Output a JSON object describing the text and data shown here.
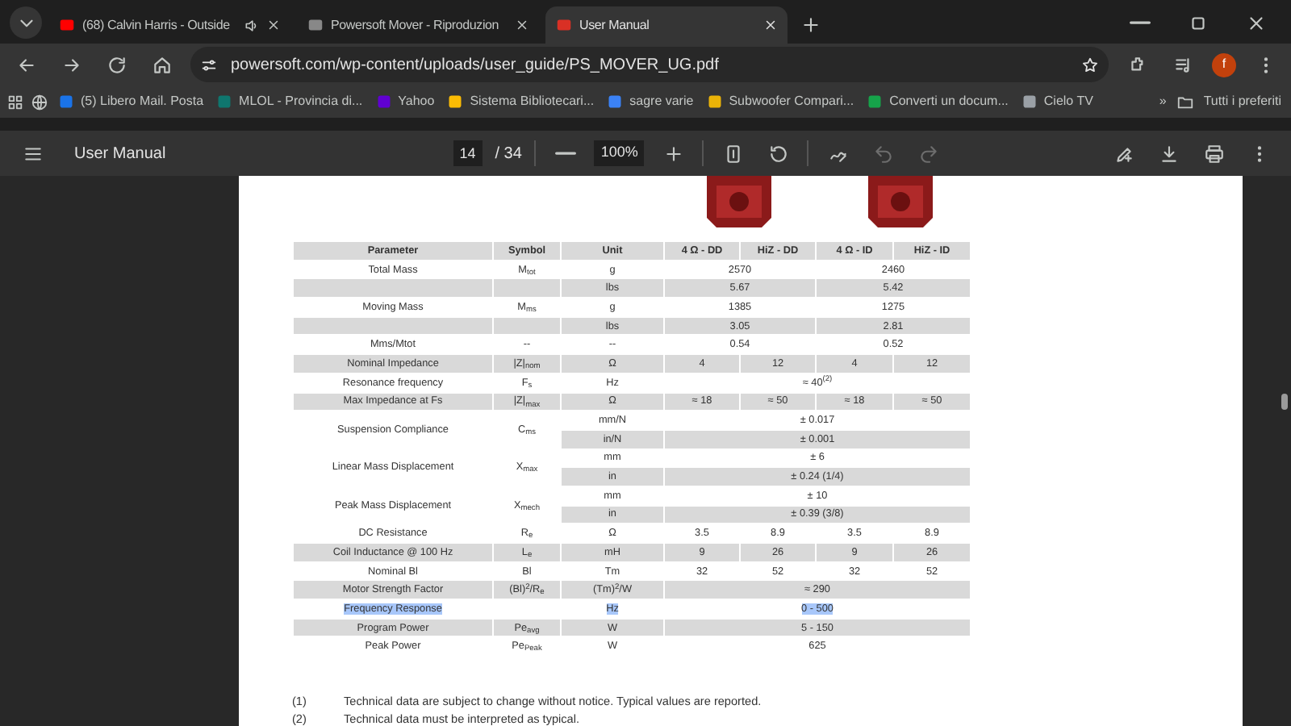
{
  "tabs": [
    {
      "title": "(68) Calvin Harris - Outside",
      "selected": false,
      "playing": true
    },
    {
      "title": "Powersoft Mover - Riproduzion",
      "selected": false,
      "playing": false
    },
    {
      "title": "User Manual",
      "selected": true,
      "playing": false
    }
  ],
  "address_bar": {
    "url": "powersoft.com/wp-content/uploads/user_guide/PS_MOVER_UG.pdf",
    "avatar": "f"
  },
  "bookmarks": [
    "(5) Libero Mail. Posta",
    "MLOL - Provincia di...",
    "Yahoo",
    "Sistema Bibliotecari...",
    "sagre varie",
    "Subwoofer Compari...",
    "Converti un docum...",
    "Cielo TV"
  ],
  "bookmarks_overflow": "»",
  "bookmarks_folder": "Tutti i preferiti",
  "pdf_toolbar": {
    "title": "User Manual",
    "page": "14",
    "page_count": "/ 34",
    "zoom": "100%",
    "undo_disabled": true,
    "redo_disabled": true
  },
  "table": {
    "columns": [
      "Parameter",
      "Symbol",
      "Unit",
      "4 Ω - DD",
      "HiZ - DD",
      "4 Ω - ID",
      "HiZ - ID"
    ],
    "rows": [
      {
        "parameter": "Total Mass",
        "symbol": "M$_{tot}$",
        "merged": false,
        "highlighted": false,
        "lines": [
          {
            "unit": "g",
            "values": [
              "2570",
              "2460"
            ],
            "shaded": false
          },
          {
            "unit": "lbs",
            "values": [
              "5.67",
              "5.42"
            ],
            "shaded": true
          }
        ]
      },
      {
        "parameter": "Moving Mass",
        "symbol": "M$_{ms}$",
        "merged": false,
        "highlighted": false,
        "lines": [
          {
            "unit": "g",
            "values": [
              "1385",
              "1275"
            ],
            "shaded": false
          },
          {
            "unit": "lbs",
            "values": [
              "3.05",
              "2.81"
            ],
            "shaded": true
          }
        ]
      },
      {
        "parameter": "Mms/Mtot",
        "symbol": "--",
        "merged": false,
        "highlighted": false,
        "lines": [
          {
            "unit": "--",
            "values": [
              "0.54",
              "0.52"
            ],
            "shaded": false
          }
        ]
      },
      {
        "parameter": "Nominal Impedance",
        "symbol": "|Z|$_{nom}$",
        "merged": false,
        "highlighted": false,
        "lines": [
          {
            "unit": "Ω",
            "values": [
              "4",
              "12",
              "4",
              "12"
            ],
            "shaded": true
          }
        ]
      },
      {
        "parameter": "Resonance frequency",
        "symbol": "F$_{s}$",
        "merged": false,
        "highlighted": false,
        "lines": [
          {
            "unit": "Hz",
            "values": [
              "≈ 40$^{(2)}$"
            ],
            "shaded": false
          }
        ]
      },
      {
        "parameter": "Max Impedance at Fs",
        "symbol": "|Z|$_{max}$",
        "merged": false,
        "highlighted": false,
        "lines": [
          {
            "unit": "Ω",
            "values": [
              "≈ 18",
              "≈ 50",
              "≈ 18",
              "≈ 50"
            ],
            "shaded": true
          }
        ]
      },
      {
        "parameter": "Suspension Compliance",
        "symbol": "C$_{ms}$",
        "merged": true,
        "highlighted": false,
        "lines": [
          {
            "unit": "mm/N",
            "values": [
              "± 0.017"
            ],
            "shaded": false
          },
          {
            "unit": "in/N",
            "values": [
              "± 0.001"
            ],
            "shaded": true
          }
        ]
      },
      {
        "parameter": "Linear Mass Displacement",
        "symbol": "X$_{max}$",
        "merged": true,
        "highlighted": false,
        "lines": [
          {
            "unit": "mm",
            "values": [
              "± 6"
            ],
            "shaded": false
          },
          {
            "unit": "in",
            "values": [
              "± 0.24 (1/4)"
            ],
            "shaded": true
          }
        ]
      },
      {
        "parameter": "Peak Mass Displacement",
        "symbol": "X$_{mech}$",
        "merged": true,
        "highlighted": false,
        "lines": [
          {
            "unit": "mm",
            "values": [
              "± 10"
            ],
            "shaded": false
          },
          {
            "unit": "in",
            "values": [
              "± 0.39 (3/8)"
            ],
            "shaded": true
          }
        ]
      },
      {
        "parameter": "DC Resistance",
        "symbol": "R$_{e}$",
        "merged": false,
        "highlighted": false,
        "lines": [
          {
            "unit": "Ω",
            "values": [
              "3.5",
              "8.9",
              "3.5",
              "8.9"
            ],
            "shaded": false
          }
        ]
      },
      {
        "parameter": "Coil Inductance @ 100 Hz",
        "symbol": "L$_{e}$",
        "merged": false,
        "highlighted": false,
        "lines": [
          {
            "unit": "mH",
            "values": [
              "9",
              "26",
              "9",
              "26"
            ],
            "shaded": true
          }
        ]
      },
      {
        "parameter": "Nominal Bl",
        "symbol": "Bl",
        "merged": false,
        "highlighted": false,
        "lines": [
          {
            "unit": "Tm",
            "values": [
              "32",
              "52",
              "32",
              "52"
            ],
            "shaded": false
          }
        ]
      },
      {
        "parameter": "Motor Strength Factor",
        "symbol": "(Bl)$^{2}$/R$_{e}$",
        "merged": false,
        "highlighted": false,
        "lines": [
          {
            "unit": "(Tm)$^{2}$/W",
            "values": [
              "≈ 290"
            ],
            "shaded": true
          }
        ]
      },
      {
        "parameter": "Frequency Response",
        "merged": false,
        "highlighted": true,
        "lines": [
          {
            "unit": "Hz",
            "values": [
              "0 - 500"
            ],
            "shaded": false
          }
        ]
      },
      {
        "parameter": "Program Power",
        "symbol": "Pe$_{avg}$",
        "merged": false,
        "highlighted": false,
        "lines": [
          {
            "unit": "W",
            "values": [
              "5 - 150"
            ],
            "shaded": true
          }
        ]
      },
      {
        "parameter": "Peak Power",
        "symbol": "Pe$_{Peak}$",
        "merged": false,
        "highlighted": false,
        "lines": [
          {
            "unit": "W",
            "values": [
              "625"
            ],
            "shaded": false
          }
        ]
      }
    ]
  },
  "footnotes": [
    {
      "mark": "(1)",
      "text": "Technical data are subject to change without notice. Typical values are reported."
    },
    {
      "mark": "(2)",
      "text": "Technical data must be interpreted as typical."
    }
  ]
}
